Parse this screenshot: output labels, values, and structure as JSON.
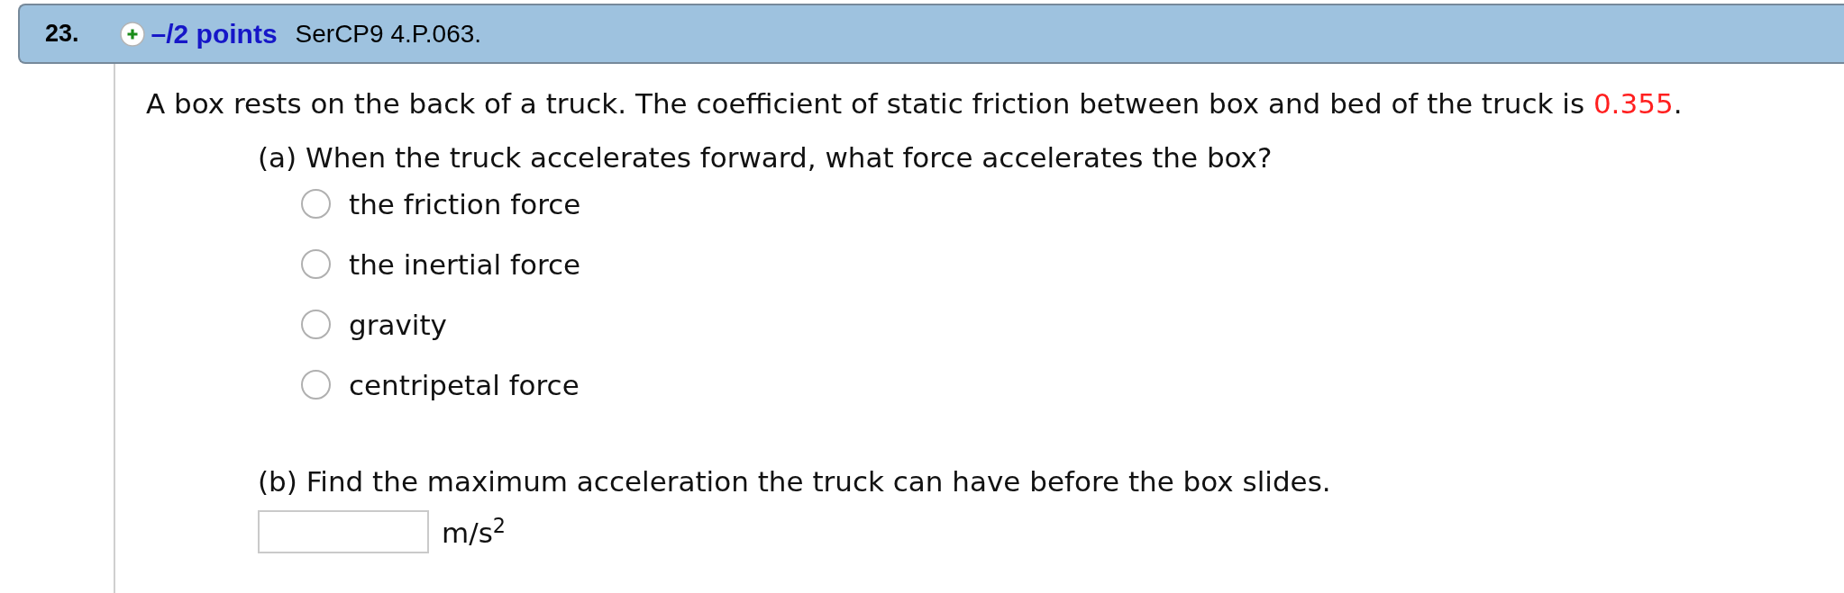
{
  "question": {
    "number": "23.",
    "points": "–/2 points",
    "source": "SerCP9 4.P.063."
  },
  "prompt": [
    {
      "kind": "plain",
      "text": "A box rests on the back of a truck. The coefficient of static friction between box and bed of the truck is "
    },
    {
      "kind": "value",
      "text": "0.355"
    },
    {
      "kind": "plain",
      "text": "."
    }
  ],
  "parts": [
    {
      "kind": "multiple_choice",
      "label": "(a) When the truck accelerates forward, what force accelerates the box?",
      "options": [
        {
          "label": "the friction force",
          "selected": false
        },
        {
          "label": "the inertial force",
          "selected": false
        },
        {
          "label": "gravity",
          "selected": false
        },
        {
          "label": "centripetal force",
          "selected": false
        }
      ]
    },
    {
      "kind": "numeric",
      "label": "(b) Find the maximum acceleration the truck can have before the box slides.",
      "unit": "m/s$^{2}$"
    }
  ]
}
